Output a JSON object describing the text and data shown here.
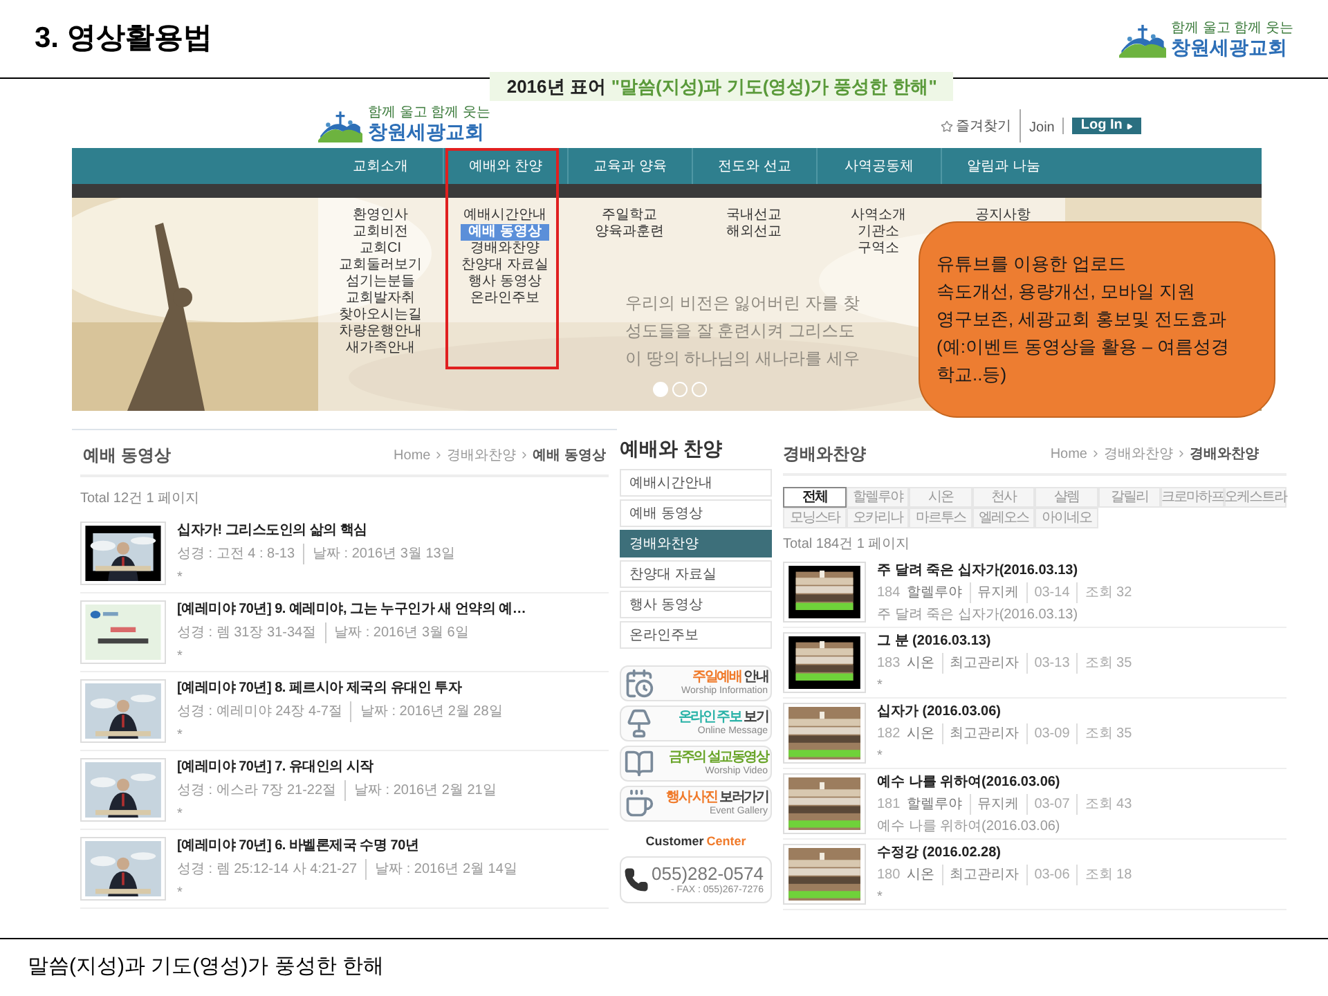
{
  "slide": {
    "title": "3. 영상활용법",
    "logo": {
      "tagline": "함께 울고 함께 웃는",
      "name": "창원세광교회"
    },
    "footer": "말씀(지성)과 기도(영성)가 풍성한 한해"
  },
  "site_header": {
    "logo": {
      "tagline": "함께 울고 함께 웃는",
      "name": "창원세광교회"
    },
    "motto_label": "2016년 표어",
    "motto": "\"말씀(지성)과 기도(영성)가 풍성한 한해\"",
    "links": [
      {
        "label": "즐겨찾기",
        "kind": "favorite"
      },
      {
        "label": "Join",
        "kind": "text"
      },
      {
        "label": "Log In",
        "kind": "button"
      }
    ]
  },
  "nav": [
    {
      "label": "교회소개",
      "highlighted": false,
      "children": [
        {
          "label": "환영인사",
          "selected": false
        },
        {
          "label": "교회비전",
          "selected": false
        },
        {
          "label": "교회CI",
          "selected": false
        },
        {
          "label": "교회둘러보기",
          "selected": false
        },
        {
          "label": "섬기는분들",
          "selected": false
        },
        {
          "label": "교회발자취",
          "selected": false
        },
        {
          "label": "찾아오시는길",
          "selected": false
        },
        {
          "label": "차량운행안내",
          "selected": false
        },
        {
          "label": "새가족안내",
          "selected": false
        }
      ]
    },
    {
      "label": "예배와 찬양",
      "highlighted": true,
      "children": [
        {
          "label": "예배시간안내",
          "selected": false
        },
        {
          "label": "예배 동영상",
          "selected": true
        },
        {
          "label": "경배와찬양",
          "selected": false
        },
        {
          "label": "찬양대 자료실",
          "selected": false
        },
        {
          "label": "행사 동영상",
          "selected": false
        },
        {
          "label": "온라인주보",
          "selected": false
        }
      ]
    },
    {
      "label": "교육과 양육",
      "highlighted": false,
      "children": [
        {
          "label": "주일학교",
          "selected": false
        },
        {
          "label": "양육과훈련",
          "selected": false
        }
      ]
    },
    {
      "label": "전도와 선교",
      "highlighted": false,
      "children": [
        {
          "label": "국내선교",
          "selected": false
        },
        {
          "label": "해외선교",
          "selected": false
        }
      ]
    },
    {
      "label": "사역공동체",
      "highlighted": false,
      "children": [
        {
          "label": "사역소개",
          "selected": false
        },
        {
          "label": "기관소",
          "selected": false
        },
        {
          "label": "구역소",
          "selected": false
        }
      ]
    },
    {
      "label": "알림과 나눔",
      "highlighted": false,
      "children": [
        {
          "label": "공지사항",
          "selected": false
        }
      ]
    }
  ],
  "banner": {
    "lines": [
      "우리의 비전은 잃어버린 자를 찾",
      "성도들을 잘 훈련시켜 그리스도",
      "이 땅의 하나님의 새나라를 세우"
    ],
    "slides": [
      {
        "selected": true
      },
      {
        "selected": false
      },
      {
        "selected": false
      }
    ]
  },
  "callout": {
    "lines": [
      "유튜브를 이용한 업로드",
      "속도개선, 용량개선, 모바일 지원",
      "영구보존, 세광교회 홍보및 전도효과",
      "(예:이벤트 동영상을 활용 – 여름성경",
      "학교..등)"
    ]
  },
  "video_page": {
    "title": "예배 동영상",
    "breadcrumb": [
      "Home",
      "경배와찬양",
      "예배 동영상"
    ],
    "total": "Total 12건 1 페이지",
    "rows": [
      {
        "title": "십자가! 그리스도인의 삶의 핵심",
        "scripture": "성경 : 고전 4 : 8-13",
        "date": "날짜 : 2016년 3월 13일",
        "mark": "*"
      },
      {
        "title": "[예레미야 70년] 9. 예레미야, 그는 누구인가 새 언약의 예…",
        "scripture": "성경 : 렘 31장 31-34절",
        "date": "날짜 : 2016년 3월 6일",
        "mark": "*"
      },
      {
        "title": "[예레미야 70년] 8. 페르시아 제국의 유대인 투자",
        "scripture": "성경 : 예레미야 24장 4-7절",
        "date": "날짜 : 2016년 2월 28일",
        "mark": "*"
      },
      {
        "title": "[예레미야 70년] 7. 유대인의 시작",
        "scripture": "성경 : 에스라 7장 21-22절",
        "date": "날짜 : 2016년 2월 21일",
        "mark": "*"
      },
      {
        "title": "[예레미야 70년] 6. 바벨론제국 수명 70년",
        "scripture": "성경 : 렘 25:12-14 사 4:21-27",
        "date": "날짜 : 2016년 2월 14일",
        "mark": "*"
      }
    ]
  },
  "sidebar": {
    "title": "예배와 찬양",
    "items": [
      {
        "label": "예배시간안내",
        "selected": false
      },
      {
        "label": "예배 동영상",
        "selected": false
      },
      {
        "label": "경배와찬양",
        "selected": true
      },
      {
        "label": "찬양대 자료실",
        "selected": false
      },
      {
        "label": "행사 동영상",
        "selected": false
      },
      {
        "label": "온라인주보",
        "selected": false
      }
    ],
    "banners": [
      {
        "kind": "calendar",
        "accent": "주일예배",
        "title": "안내",
        "subtitle": "Worship Information",
        "color": "#f07a2a"
      },
      {
        "kind": "lamp",
        "accent": "온라인 주보",
        "title": "보기",
        "subtitle": "Online Message",
        "color": "#2bb3a8"
      },
      {
        "kind": "book",
        "accent": "금주의 설교동영상",
        "subtitle": "Worship Video",
        "color": "#6aa52a"
      },
      {
        "kind": "cup",
        "accent": "행사 사진",
        "title": "보러가기",
        "subtitle": "Event Gallery",
        "color": "#f07a2a"
      }
    ],
    "customer_center": {
      "label": "Customer",
      "accent": "Center",
      "phone": "055)282-0574",
      "fax": "- FAX : 055)267-7276"
    }
  },
  "praise_page": {
    "title": "경배와찬양",
    "breadcrumb": [
      "Home",
      "경배와찬양",
      "경배와찬양"
    ],
    "tabs": [
      {
        "label": "전체",
        "selected": true
      },
      {
        "label": "할렐루야",
        "selected": false
      },
      {
        "label": "시온",
        "selected": false
      },
      {
        "label": "천사",
        "selected": false
      },
      {
        "label": "샬렘",
        "selected": false
      },
      {
        "label": "갈릴리",
        "selected": false
      },
      {
        "label": "크로마하프",
        "selected": false
      },
      {
        "label": "오케스트라",
        "selected": false
      },
      {
        "label": "모닝스타",
        "selected": false
      },
      {
        "label": "오카리나",
        "selected": false
      },
      {
        "label": "마르투스",
        "selected": false
      },
      {
        "label": "엘레오스",
        "selected": false
      },
      {
        "label": "아이네오",
        "selected": false
      }
    ],
    "total": "Total 184건 1 페이지",
    "rows": [
      {
        "title": "주 달려 죽은 십자가(2016.03.13)",
        "number": "184",
        "category": "할렐루야",
        "author": "뮤지케",
        "date": "03-14",
        "views": "조회 32",
        "summary": "주 달려 죽은 십자가(2016.03.13)"
      },
      {
        "title": "그 분 (2016.03.13)",
        "number": "183",
        "category": "시온",
        "author": "최고관리자",
        "date": "03-13",
        "views": "조회 35",
        "summary": "*"
      },
      {
        "title": "십자가 (2016.03.06)",
        "number": "182",
        "category": "시온",
        "author": "최고관리자",
        "date": "03-09",
        "views": "조회 35",
        "summary": "*"
      },
      {
        "title": "예수 나를 위하여(2016.03.06)",
        "number": "181",
        "category": "할렐루야",
        "author": "뮤지케",
        "date": "03-07",
        "views": "조회 43",
        "summary": "예수 나를 위하여(2016.03.06)"
      },
      {
        "title": "수정강 (2016.02.28)",
        "number": "180",
        "category": "시온",
        "author": "최고관리자",
        "date": "03-06",
        "views": "조회 18",
        "summary": "*"
      }
    ]
  }
}
